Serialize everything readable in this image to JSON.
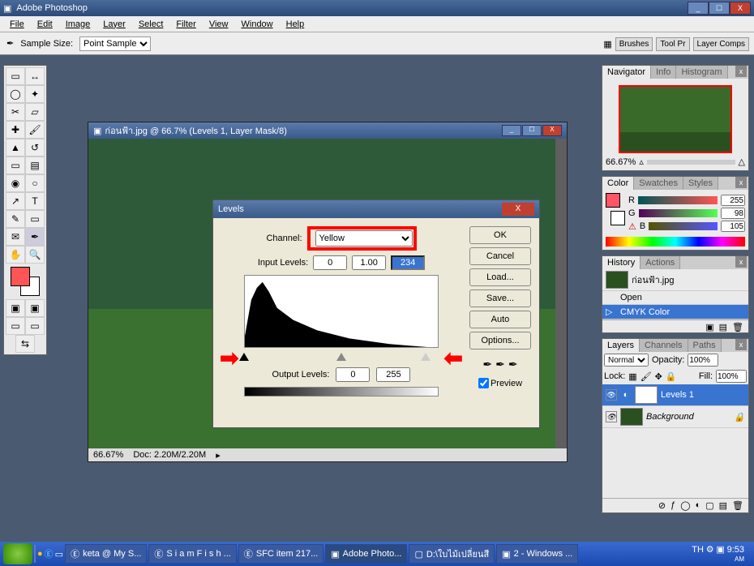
{
  "app_title": "Adobe Photoshop",
  "menus": [
    "File",
    "Edit",
    "Image",
    "Layer",
    "Select",
    "Filter",
    "View",
    "Window",
    "Help"
  ],
  "optionbar": {
    "sample_label": "Sample Size:",
    "sample_value": "Point Sample"
  },
  "palette_well": [
    "Brushes",
    "Tool Pr",
    "Layer Comps"
  ],
  "doc": {
    "title": "ก่อนฟ้า.jpg @ 66.7% (Levels 1, Layer Mask/8)",
    "zoom": "66.67%",
    "docsize": "Doc: 2.20M/2.20M"
  },
  "navigator": {
    "tabs": [
      "Navigator",
      "Info",
      "Histogram"
    ],
    "zoom": "66.67%"
  },
  "color": {
    "tabs": [
      "Color",
      "Swatches",
      "Styles"
    ],
    "r": {
      "label": "R",
      "value": "255"
    },
    "g": {
      "label": "G",
      "value": "98"
    },
    "b": {
      "label": "B",
      "value": "105"
    }
  },
  "history": {
    "tabs": [
      "History",
      "Actions"
    ],
    "doc_item": "ก่อนฟ้า.jpg",
    "items": [
      "Open",
      "CMYK Color"
    ],
    "selected": 1
  },
  "layers": {
    "tabs": [
      "Layers",
      "Channels",
      "Paths"
    ],
    "blend": "Normal",
    "opacity_label": "Opacity:",
    "opacity": "100%",
    "lock_label": "Lock:",
    "fill_label": "Fill:",
    "fill": "100%",
    "items": [
      {
        "name": "Levels 1",
        "selected": true,
        "type": "adjustment"
      },
      {
        "name": "Background",
        "selected": false,
        "type": "bg"
      }
    ]
  },
  "levels": {
    "title": "Levels",
    "channel_label": "Channel:",
    "channel": "Yellow",
    "input_label": "Input Levels:",
    "in_black": "0",
    "in_gamma": "1.00",
    "in_white": "234",
    "output_label": "Output Levels:",
    "out_black": "0",
    "out_white": "255",
    "buttons": {
      "ok": "OK",
      "cancel": "Cancel",
      "load": "Load...",
      "save": "Save...",
      "auto": "Auto",
      "options": "Options..."
    },
    "preview": "Preview"
  },
  "taskbar": {
    "items": [
      "keta @ My S...",
      "S i a m F i s h ...",
      "SFC item 217...",
      "Adobe Photo...",
      "D:\\ใบไม้เปลี่ยนสี",
      "2 - Windows ..."
    ],
    "active": 3,
    "lang": "TH",
    "time": "9:53",
    "ampm": "AM"
  }
}
